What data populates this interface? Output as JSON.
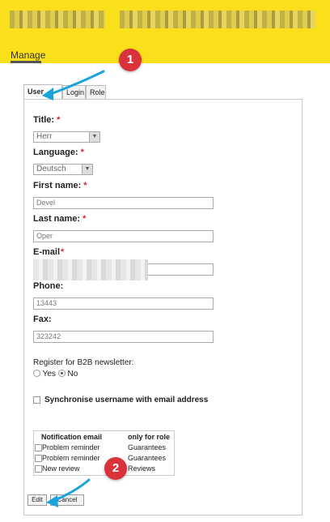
{
  "header": {
    "manage_label": "Manage"
  },
  "annotations": {
    "badge1": "1",
    "badge2": "2"
  },
  "tabs": [
    {
      "label": "User data"
    },
    {
      "label": "Login"
    },
    {
      "label": "Role"
    }
  ],
  "form": {
    "title_label": "Title:",
    "title_value": "Herr",
    "language_label": "Language:",
    "language_value": "Deutsch",
    "first_name_label": "First name:",
    "first_name_value": "Devel",
    "last_name_label": "Last name:",
    "last_name_value": "Oper",
    "email_label": "E-mail",
    "email_value": "",
    "phone_label": "Phone:",
    "phone_value": "13443",
    "fax_label": "Fax:",
    "fax_value": "323242",
    "required_marker": "*",
    "newsletter_label": "Register for B2B newsletter:",
    "newsletter_yes": "Yes",
    "newsletter_no": "No",
    "newsletter_selected": "No",
    "sync_label": "Synchronise username with email address"
  },
  "notifications": {
    "header_email": "Notification email",
    "header_role": "only for role",
    "rows": [
      {
        "email": "Problem reminder",
        "role": "Guarantees"
      },
      {
        "email": "Problem reminder",
        "role": "Guarantees"
      },
      {
        "email": "New review",
        "role": "Reviews"
      }
    ]
  },
  "buttons": {
    "edit": "Edit",
    "cancel": "Cancel"
  },
  "colors": {
    "header_bg": "#f9e01a",
    "badge": "#d9323b",
    "arrow": "#1aa3dc",
    "required": "#dd2233"
  }
}
